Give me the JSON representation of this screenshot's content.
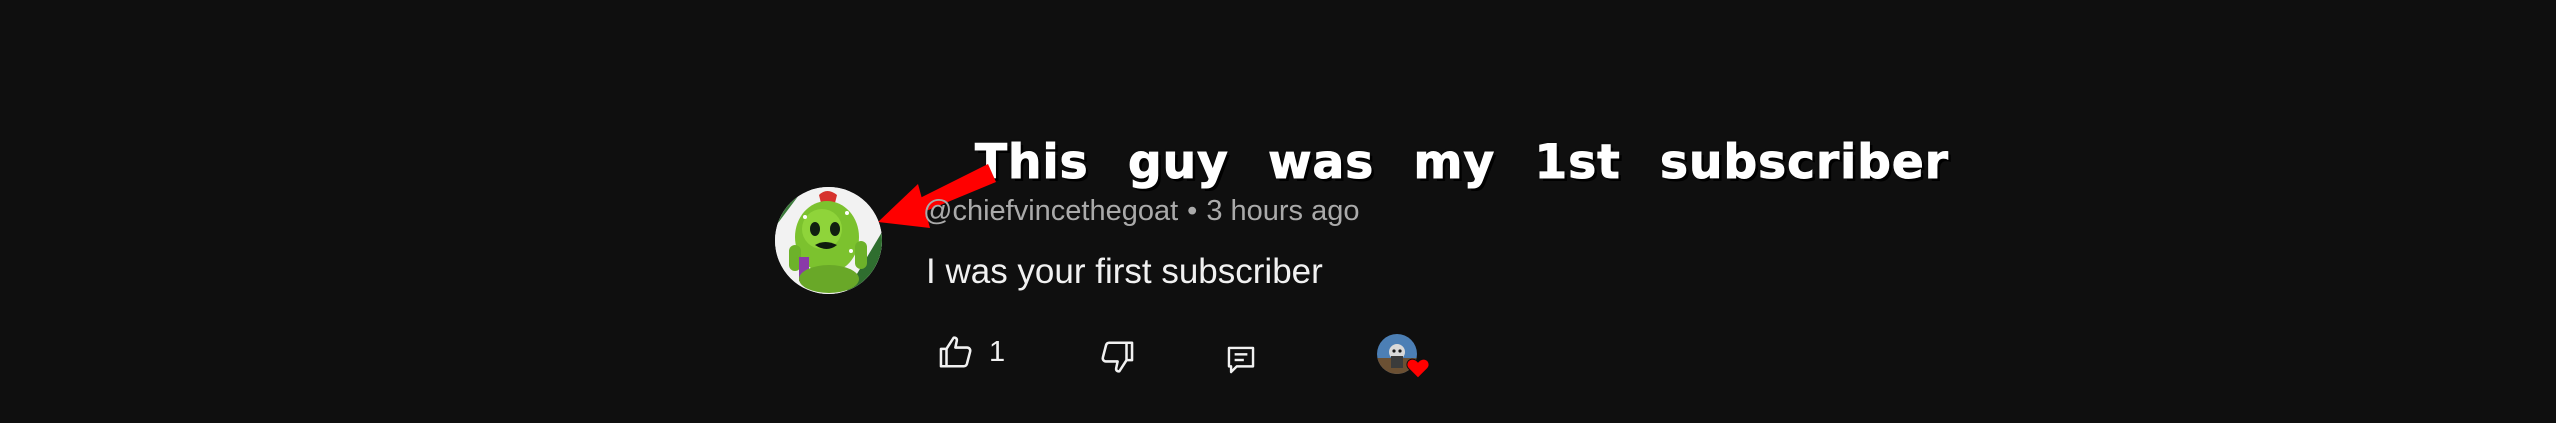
{
  "overlay": {
    "caption": "This guy was my 1st subscriber",
    "arrow_color": "#ff0000",
    "arrow_icon": "red-arrow-icon"
  },
  "comment": {
    "avatar_icon": "spike-cactus-avatar",
    "handle": "@chiefvincethegoat",
    "separator": "•",
    "time": "3 hours ago",
    "text": "I was your first subscriber",
    "likes": "1"
  },
  "actions": {
    "like_icon": "thumbs-up-icon",
    "dislike_icon": "thumbs-down-icon",
    "reply_icon": "reply-comment-icon",
    "creator_heart_icon": "creator-heart-icon",
    "heart_color": "#ff0000"
  },
  "colors": {
    "background": "#0f0f0f",
    "text_primary": "#f1f1f1",
    "text_secondary": "#aaaaaa"
  }
}
